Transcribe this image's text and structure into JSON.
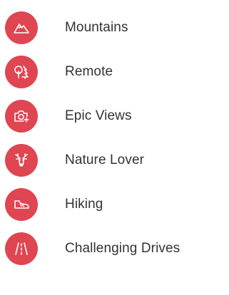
{
  "accent_color": "#E04552",
  "items": [
    {
      "label": "Mountains",
      "icon": "mountain-icon"
    },
    {
      "label": "Remote",
      "icon": "trees-icon"
    },
    {
      "label": "Epic Views",
      "icon": "camera-icon"
    },
    {
      "label": "Nature Lover",
      "icon": "deer-icon"
    },
    {
      "label": "Hiking",
      "icon": "hiking-boot-icon"
    },
    {
      "label": "Challenging Drives",
      "icon": "road-icon"
    }
  ]
}
